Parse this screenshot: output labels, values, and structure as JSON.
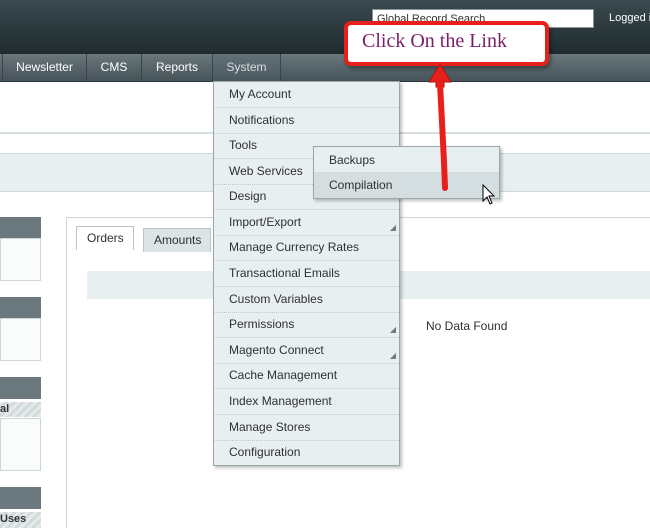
{
  "header": {
    "search_value": "Global Record Search",
    "logged_text": "Logged i"
  },
  "nav": {
    "items": [
      "Newsletter",
      "CMS",
      "Reports",
      "System"
    ],
    "active": "System"
  },
  "dashboard": {
    "tabs": [
      "Orders",
      "Amounts"
    ],
    "left_labels": [
      "al",
      "Uses"
    ],
    "no_data": "No Data Found"
  },
  "system_menu": {
    "items": [
      {
        "label": "My Account",
        "has_submenu": false
      },
      {
        "label": "Notifications",
        "has_submenu": false
      },
      {
        "label": "Tools",
        "has_submenu": true
      },
      {
        "label": "Web Services",
        "has_submenu": false
      },
      {
        "label": "Design",
        "has_submenu": false
      },
      {
        "label": "Import/Export",
        "has_submenu": true
      },
      {
        "label": "Manage Currency Rates",
        "has_submenu": false
      },
      {
        "label": "Transactional Emails",
        "has_submenu": false
      },
      {
        "label": "Custom Variables",
        "has_submenu": false
      },
      {
        "label": "Permissions",
        "has_submenu": true
      },
      {
        "label": "Magento Connect",
        "has_submenu": true
      },
      {
        "label": "Cache Management",
        "has_submenu": false
      },
      {
        "label": "Index Management",
        "has_submenu": false
      },
      {
        "label": "Manage Stores",
        "has_submenu": false
      },
      {
        "label": "Configuration",
        "has_submenu": false
      }
    ]
  },
  "tools_submenu": {
    "items": [
      "Backups",
      "Compilation"
    ],
    "hovered": "Compilation"
  },
  "annotation": {
    "text": "Click On the Link",
    "border_color": "#e8201b",
    "text_color": "#7a1f6a"
  },
  "icons": {
    "submenu_indicator": "corner-triangle-icon",
    "pointer": "mouse-cursor-icon",
    "annotation_arrow": "red-arrow-icon"
  }
}
